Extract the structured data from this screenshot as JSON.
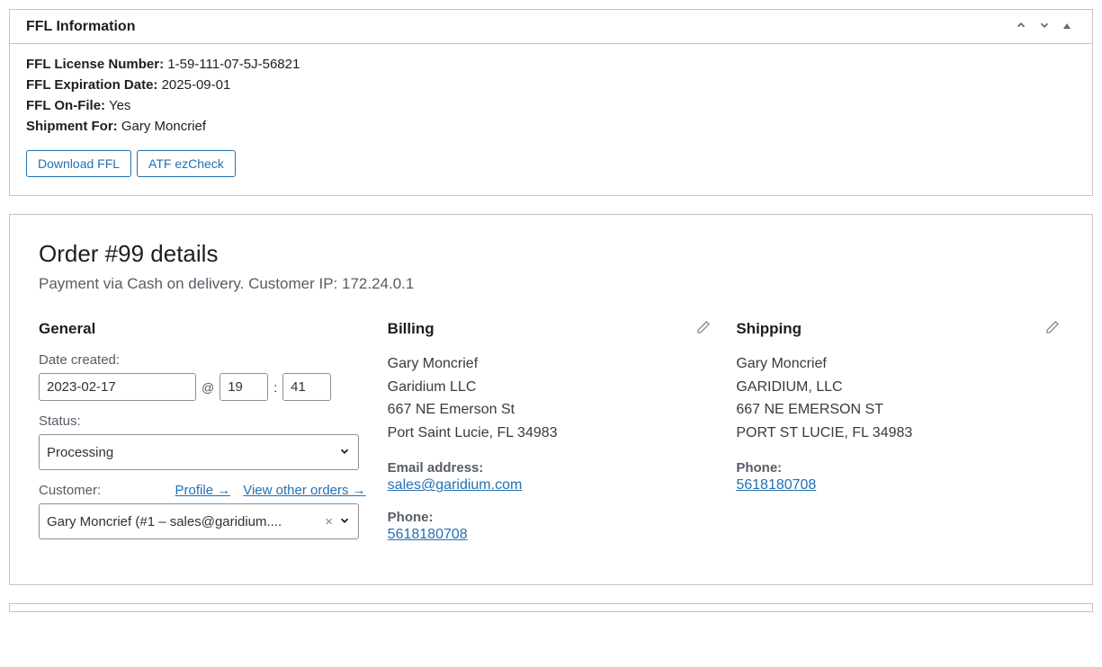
{
  "ffl": {
    "panel_title": "FFL Information",
    "license_label": "FFL License Number:",
    "license_value": "1-59-111-07-5J-56821",
    "expiration_label": "FFL Expiration Date:",
    "expiration_value": "2025-09-01",
    "onfile_label": "FFL On-File:",
    "onfile_value": "Yes",
    "shipment_label": "Shipment For:",
    "shipment_value": "Gary Moncrief",
    "download_btn": "Download FFL",
    "ezcheck_btn": "ATF ezCheck"
  },
  "order": {
    "title": "Order #99 details",
    "subtitle": "Payment via Cash on delivery. Customer IP: 172.24.0.1",
    "general": {
      "heading": "General",
      "date_label": "Date created:",
      "date": "2023-02-17",
      "at": "@",
      "hour": "19",
      "minute": "41",
      "status_label": "Status:",
      "status_value": "Processing",
      "customer_label": "Customer:",
      "profile_link": "Profile →",
      "other_orders_link": "View other orders →",
      "customer_value": "Gary Moncrief (#1 – sales@garidium...."
    },
    "billing": {
      "heading": "Billing",
      "name": "Gary Moncrief",
      "company": "Garidium LLC",
      "street": "667 NE Emerson St",
      "city": "Port Saint Lucie, FL 34983",
      "email_label": "Email address:",
      "email": "sales@garidium.com",
      "phone_label": "Phone:",
      "phone": "5618180708"
    },
    "shipping": {
      "heading": "Shipping",
      "name": "Gary Moncrief",
      "company": "GARIDIUM, LLC",
      "street": "667 NE EMERSON ST",
      "city": "PORT ST LUCIE, FL 34983",
      "phone_label": "Phone:",
      "phone": "5618180708"
    }
  }
}
